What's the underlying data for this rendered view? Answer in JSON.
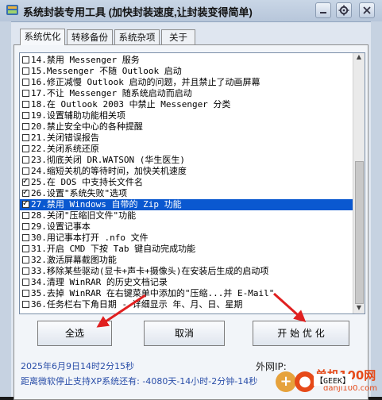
{
  "window": {
    "title": "系统封装专用工具 (加快封装速度,让封装变得简单)"
  },
  "tabs": [
    {
      "label": "系统优化",
      "active": true
    },
    {
      "label": "转移备份",
      "active": false
    },
    {
      "label": "系统杂项",
      "active": false
    },
    {
      "label": "关于",
      "active": false
    }
  ],
  "list": {
    "items": [
      {
        "text": "14.禁用 Messenger 服务",
        "checked": false
      },
      {
        "text": "15.Messenger 不随 Outlook 启动",
        "checked": false
      },
      {
        "text": "16.修正减慢 Outlook 启动的问题，并且禁止了动画屏幕",
        "checked": false
      },
      {
        "text": "17.不让 Messenger 随系统启动而启动",
        "checked": false
      },
      {
        "text": "18.在 Outlook 2003 中禁止 Messenger 分类",
        "checked": false
      },
      {
        "text": "19.设置辅助功能相关项",
        "checked": false
      },
      {
        "text": "20.禁止安全中心的各种提醒",
        "checked": false
      },
      {
        "text": "21.关闭错误报告",
        "checked": false
      },
      {
        "text": "22.关闭系统还原",
        "checked": false
      },
      {
        "text": "23.彻底关闭 DR.WATSON (华生医生)",
        "checked": false
      },
      {
        "text": "24.缩短关机的等待时间，加快关机速度",
        "checked": false
      },
      {
        "text": "25.在 DOS 中支持长文件名",
        "checked": true
      },
      {
        "text": "26.设置\"系统失败\"选项",
        "checked": true
      },
      {
        "text": "27.禁用 Windows 自带的 Zip 功能",
        "checked": true,
        "selected": true
      },
      {
        "text": "28.关闭\"压缩旧文件\"功能",
        "checked": false
      },
      {
        "text": "29.设置记事本",
        "checked": false
      },
      {
        "text": "30.用记事本打开 .nfo 文件",
        "checked": false
      },
      {
        "text": "31.开启 CMD 下按 Tab 键自动完成功能",
        "checked": false
      },
      {
        "text": "32.激活屏幕截图功能",
        "checked": false
      },
      {
        "text": "33.移除某些驱动(显卡+声卡+摄像头)在安装后生成的启动项",
        "checked": false
      },
      {
        "text": "34.清理 WinRAR 的历史文档记录",
        "checked": false
      },
      {
        "text": "35.去掉 WinRAR 在右键菜单中添加的\"压缩...并 E-Mail\"",
        "checked": false
      },
      {
        "text": "36.任务栏右下角日期 - 详细显示  年、月、日、星期",
        "checked": false
      }
    ]
  },
  "buttons": {
    "select_all": "全选",
    "cancel": "取消",
    "start_optimize": "开 始 优 化"
  },
  "status": {
    "datetime": "2025年6月9日14时2分15秒",
    "xp_countdown": "距离微软停止支持XP系统还有: -4080天-14小时-2分钟-14秒",
    "ip_label": "外网IP:",
    "ip_value": "【GEEK】"
  },
  "watermark": {
    "title": "单机100网",
    "url": "danji100.com"
  },
  "colors": {
    "selection": "#0a58d0",
    "annotation_arrow": "#e02020",
    "status_text": "#2a4ea8"
  }
}
